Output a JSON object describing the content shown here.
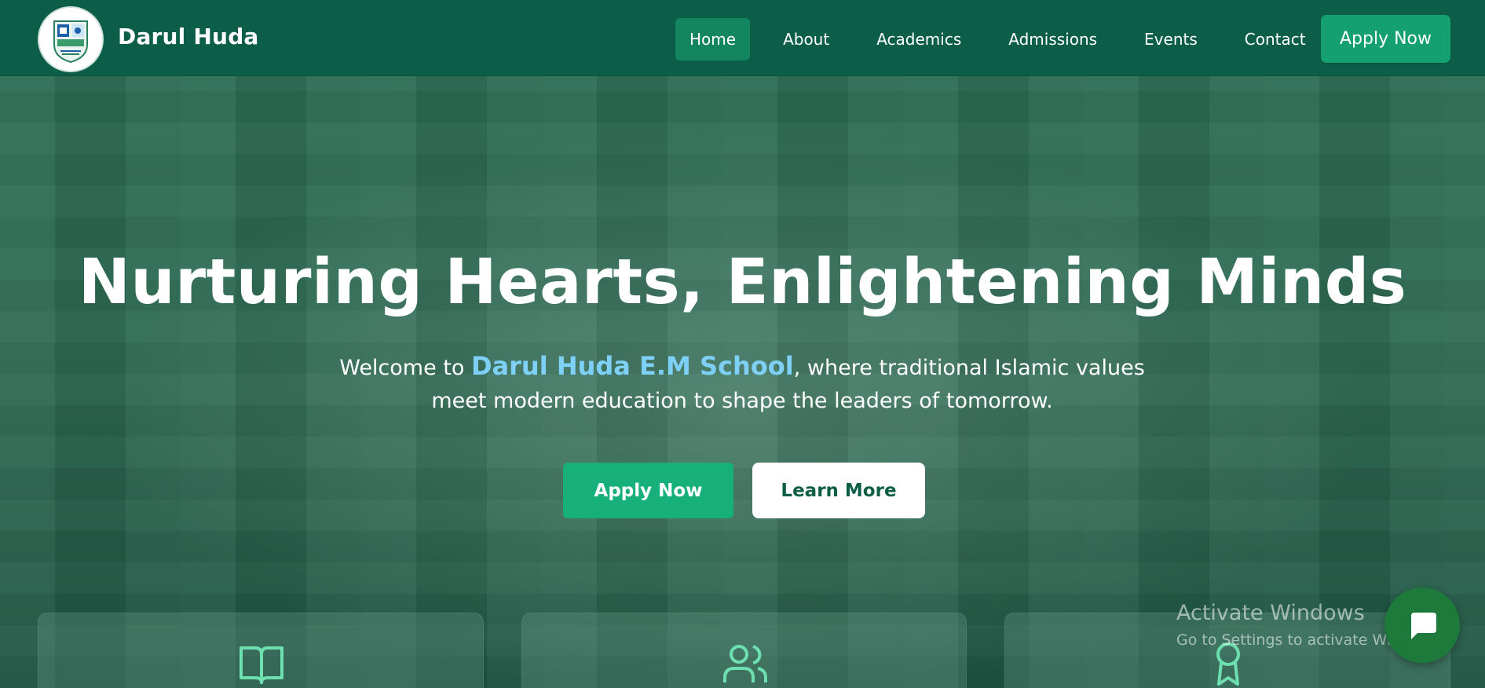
{
  "header": {
    "brand": "Darul Huda",
    "nav": [
      {
        "label": "Home",
        "active": true
      },
      {
        "label": "About"
      },
      {
        "label": "Academics"
      },
      {
        "label": "Admissions"
      },
      {
        "label": "Events"
      },
      {
        "label": "Contact"
      }
    ],
    "apply_label": "Apply Now"
  },
  "hero": {
    "title": "Nurturing Hearts, Enlightening Minds",
    "subtitle_before": "Welcome to ",
    "subtitle_school": "Darul Huda E.M School",
    "subtitle_after": ", where traditional Islamic values meet modern education to shape the leaders of tomorrow.",
    "apply_label": "Apply Now",
    "learn_label": "Learn More"
  },
  "features": [
    {
      "icon": "book-open-icon"
    },
    {
      "icon": "users-icon"
    },
    {
      "icon": "award-icon"
    }
  ],
  "watermark": {
    "line1": "Activate Windows",
    "line2": "Go to Settings to activate Windows."
  },
  "colors": {
    "header_bg": "#0c5e48",
    "accent_green": "#17b07b",
    "school_name": "#7fd0f7",
    "icon_teal": "#6ee0b0"
  }
}
